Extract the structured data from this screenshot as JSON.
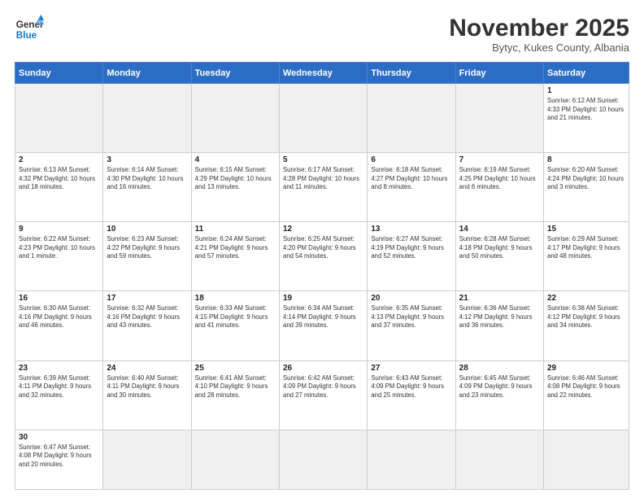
{
  "logo": {
    "text_general": "General",
    "text_blue": "Blue"
  },
  "title": "November 2025",
  "location": "Bytyc, Kukes County, Albania",
  "days_of_week": [
    "Sunday",
    "Monday",
    "Tuesday",
    "Wednesday",
    "Thursday",
    "Friday",
    "Saturday"
  ],
  "weeks": [
    [
      {
        "day": "",
        "info": "",
        "empty": true
      },
      {
        "day": "",
        "info": "",
        "empty": true
      },
      {
        "day": "",
        "info": "",
        "empty": true
      },
      {
        "day": "",
        "info": "",
        "empty": true
      },
      {
        "day": "",
        "info": "",
        "empty": true
      },
      {
        "day": "",
        "info": "",
        "empty": true
      },
      {
        "day": "1",
        "info": "Sunrise: 6:12 AM\nSunset: 4:33 PM\nDaylight: 10 hours\nand 21 minutes."
      }
    ],
    [
      {
        "day": "2",
        "info": "Sunrise: 6:13 AM\nSunset: 4:32 PM\nDaylight: 10 hours\nand 18 minutes."
      },
      {
        "day": "3",
        "info": "Sunrise: 6:14 AM\nSunset: 4:30 PM\nDaylight: 10 hours\nand 16 minutes."
      },
      {
        "day": "4",
        "info": "Sunrise: 6:15 AM\nSunset: 4:29 PM\nDaylight: 10 hours\nand 13 minutes."
      },
      {
        "day": "5",
        "info": "Sunrise: 6:17 AM\nSunset: 4:28 PM\nDaylight: 10 hours\nand 11 minutes."
      },
      {
        "day": "6",
        "info": "Sunrise: 6:18 AM\nSunset: 4:27 PM\nDaylight: 10 hours\nand 8 minutes."
      },
      {
        "day": "7",
        "info": "Sunrise: 6:19 AM\nSunset: 4:25 PM\nDaylight: 10 hours\nand 6 minutes."
      },
      {
        "day": "8",
        "info": "Sunrise: 6:20 AM\nSunset: 4:24 PM\nDaylight: 10 hours\nand 3 minutes."
      }
    ],
    [
      {
        "day": "9",
        "info": "Sunrise: 6:22 AM\nSunset: 4:23 PM\nDaylight: 10 hours\nand 1 minute."
      },
      {
        "day": "10",
        "info": "Sunrise: 6:23 AM\nSunset: 4:22 PM\nDaylight: 9 hours\nand 59 minutes."
      },
      {
        "day": "11",
        "info": "Sunrise: 6:24 AM\nSunset: 4:21 PM\nDaylight: 9 hours\nand 57 minutes."
      },
      {
        "day": "12",
        "info": "Sunrise: 6:25 AM\nSunset: 4:20 PM\nDaylight: 9 hours\nand 54 minutes."
      },
      {
        "day": "13",
        "info": "Sunrise: 6:27 AM\nSunset: 4:19 PM\nDaylight: 9 hours\nand 52 minutes."
      },
      {
        "day": "14",
        "info": "Sunrise: 6:28 AM\nSunset: 4:18 PM\nDaylight: 9 hours\nand 50 minutes."
      },
      {
        "day": "15",
        "info": "Sunrise: 6:29 AM\nSunset: 4:17 PM\nDaylight: 9 hours\nand 48 minutes."
      }
    ],
    [
      {
        "day": "16",
        "info": "Sunrise: 6:30 AM\nSunset: 4:16 PM\nDaylight: 9 hours\nand 46 minutes."
      },
      {
        "day": "17",
        "info": "Sunrise: 6:32 AM\nSunset: 4:16 PM\nDaylight: 9 hours\nand 43 minutes."
      },
      {
        "day": "18",
        "info": "Sunrise: 6:33 AM\nSunset: 4:15 PM\nDaylight: 9 hours\nand 41 minutes."
      },
      {
        "day": "19",
        "info": "Sunrise: 6:34 AM\nSunset: 4:14 PM\nDaylight: 9 hours\nand 39 minutes."
      },
      {
        "day": "20",
        "info": "Sunrise: 6:35 AM\nSunset: 4:13 PM\nDaylight: 9 hours\nand 37 minutes."
      },
      {
        "day": "21",
        "info": "Sunrise: 6:36 AM\nSunset: 4:12 PM\nDaylight: 9 hours\nand 36 minutes."
      },
      {
        "day": "22",
        "info": "Sunrise: 6:38 AM\nSunset: 4:12 PM\nDaylight: 9 hours\nand 34 minutes."
      }
    ],
    [
      {
        "day": "23",
        "info": "Sunrise: 6:39 AM\nSunset: 4:11 PM\nDaylight: 9 hours\nand 32 minutes."
      },
      {
        "day": "24",
        "info": "Sunrise: 6:40 AM\nSunset: 4:11 PM\nDaylight: 9 hours\nand 30 minutes."
      },
      {
        "day": "25",
        "info": "Sunrise: 6:41 AM\nSunset: 4:10 PM\nDaylight: 9 hours\nand 28 minutes."
      },
      {
        "day": "26",
        "info": "Sunrise: 6:42 AM\nSunset: 4:09 PM\nDaylight: 9 hours\nand 27 minutes."
      },
      {
        "day": "27",
        "info": "Sunrise: 6:43 AM\nSunset: 4:09 PM\nDaylight: 9 hours\nand 25 minutes."
      },
      {
        "day": "28",
        "info": "Sunrise: 6:45 AM\nSunset: 4:09 PM\nDaylight: 9 hours\nand 23 minutes."
      },
      {
        "day": "29",
        "info": "Sunrise: 6:46 AM\nSunset: 4:08 PM\nDaylight: 9 hours\nand 22 minutes."
      }
    ],
    [
      {
        "day": "30",
        "info": "Sunrise: 6:47 AM\nSunset: 4:08 PM\nDaylight: 9 hours\nand 20 minutes.",
        "last": true
      },
      {
        "day": "",
        "info": "",
        "empty": true,
        "last": true
      },
      {
        "day": "",
        "info": "",
        "empty": true,
        "last": true
      },
      {
        "day": "",
        "info": "",
        "empty": true,
        "last": true
      },
      {
        "day": "",
        "info": "",
        "empty": true,
        "last": true
      },
      {
        "day": "",
        "info": "",
        "empty": true,
        "last": true
      },
      {
        "day": "",
        "info": "",
        "empty": true,
        "last": true
      }
    ]
  ]
}
